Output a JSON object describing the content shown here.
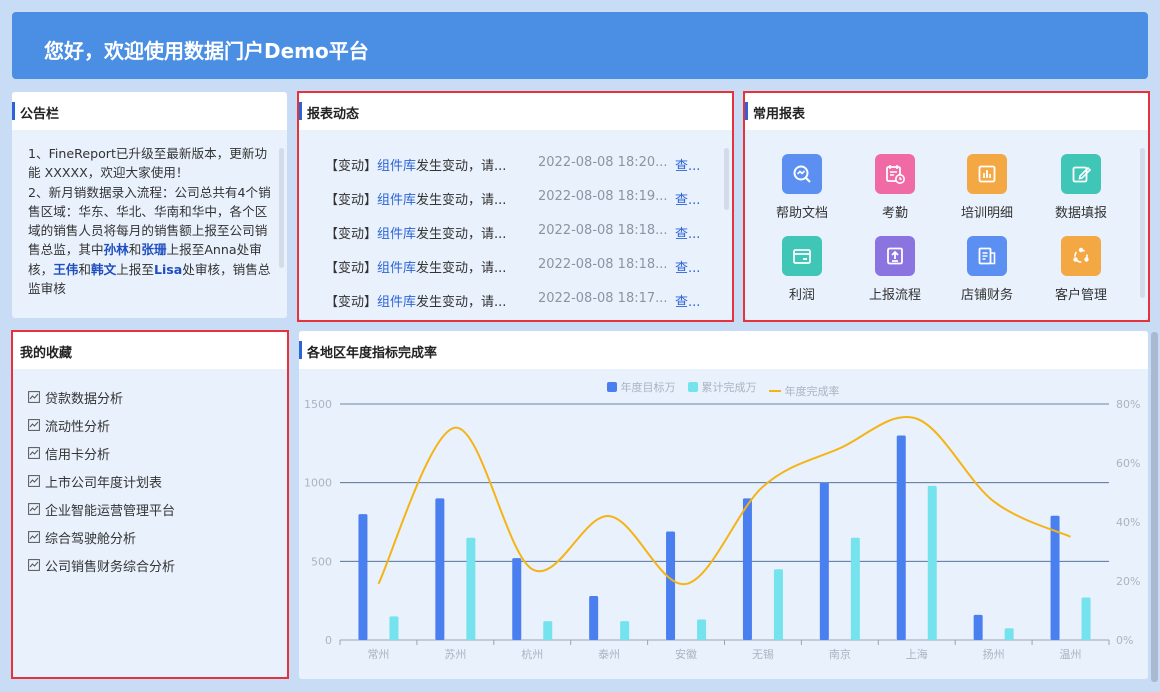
{
  "banner": {
    "title": "您好，欢迎使用数据门户Demo平台"
  },
  "notice": {
    "title": "公告栏",
    "p1": "1、FineReport已升级至最新版本，更新功能 XXXXX，欢迎大家使用！",
    "p2_a": "2、新月销数据录入流程：公司总共有4个销售区域：华东、华北、华南和华中，各个区域的销售人员将每月的销售额上报至公司销售总监，其中",
    "p2_n1": "孙林",
    "p2_b": "和",
    "p2_n2": "张珊",
    "p2_c": "上报至Anna处审核，",
    "p2_n3": "王伟",
    "p2_d": "和",
    "p2_n4": "韩文",
    "p2_e": "上报至",
    "p2_n5": "Lisa",
    "p2_f": "处审核，销售总监审核"
  },
  "feed": {
    "title": "报表动态",
    "rows": [
      {
        "tag": "【变动】",
        "link": "组件库",
        "text": "发生变动，请...",
        "time": "2022-08-08 18:20...",
        "action": "查..."
      },
      {
        "tag": "【变动】",
        "link": "组件库",
        "text": "发生变动，请...",
        "time": "2022-08-08 18:19...",
        "action": "查..."
      },
      {
        "tag": "【变动】",
        "link": "组件库",
        "text": "发生变动，请...",
        "time": "2022-08-08 18:18...",
        "action": "查..."
      },
      {
        "tag": "【变动】",
        "link": "组件库",
        "text": "发生变动，请...",
        "time": "2022-08-08 18:18...",
        "action": "查..."
      },
      {
        "tag": "【变动】",
        "link": "组件库",
        "text": "发生变动，请...",
        "time": "2022-08-08 18:17...",
        "action": "查..."
      }
    ]
  },
  "common": {
    "title": "常用报表",
    "items": [
      {
        "label": "帮助文档",
        "icon": "chart-search-icon",
        "color": "#5b8ff2"
      },
      {
        "label": "考勤",
        "icon": "calendar-clock-icon",
        "color": "#f06aa5"
      },
      {
        "label": "培训明细",
        "icon": "bar-chart-icon",
        "color": "#f4a844"
      },
      {
        "label": "数据填报",
        "icon": "edit-icon",
        "color": "#3fc6b6"
      },
      {
        "label": "利润",
        "icon": "wallet-icon",
        "color": "#3fc6b6"
      },
      {
        "label": "上报流程",
        "icon": "upload-icon",
        "color": "#8b74e0"
      },
      {
        "label": "店铺财务",
        "icon": "document-icon",
        "color": "#5b8ff2"
      },
      {
        "label": "客户管理",
        "icon": "network-icon",
        "color": "#f4a844"
      }
    ]
  },
  "favorites": {
    "title": "我的收藏",
    "items": [
      "贷款数据分析",
      "流动性分析",
      "信用卡分析",
      "上市公司年度计划表",
      "企业智能运营管理平台",
      "综合驾驶舱分析",
      "公司销售财务综合分析"
    ]
  },
  "chart_panel": {
    "title": "各地区年度指标完成率"
  },
  "chart_data": {
    "type": "bar",
    "categories": [
      "常州",
      "苏州",
      "杭州",
      "泰州",
      "安徽",
      "无锡",
      "南京",
      "上海",
      "扬州",
      "温州"
    ],
    "series": [
      {
        "name": "年度目标万",
        "type": "bar",
        "color": "#4a7ff0",
        "values": [
          800,
          900,
          520,
          280,
          690,
          900,
          1000,
          1300,
          160,
          790
        ]
      },
      {
        "name": "累计完成万",
        "type": "bar",
        "color": "#74e3ee",
        "values": [
          150,
          650,
          120,
          120,
          130,
          450,
          650,
          980,
          75,
          270
        ]
      },
      {
        "name": "年度完成率",
        "type": "line",
        "color": "#f5b416",
        "values": [
          19,
          72,
          24,
          42,
          19,
          52,
          65,
          75,
          47,
          35
        ]
      }
    ],
    "yleft": {
      "ticks": [
        "0",
        "500",
        "1000",
        "1500"
      ],
      "ylim": [
        0,
        1500
      ]
    },
    "yright": {
      "ticks": [
        "0%",
        "20%",
        "40%",
        "60%",
        "80%"
      ],
      "ylim": [
        0,
        80
      ]
    },
    "legend": "top-center",
    "grid": true
  }
}
